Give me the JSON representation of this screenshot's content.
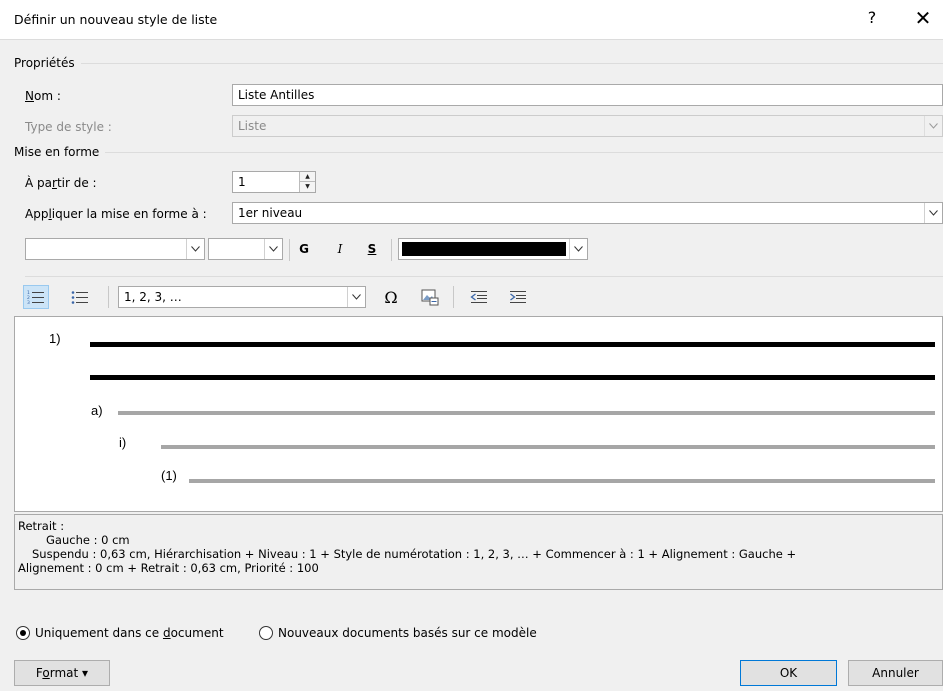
{
  "window": {
    "title": "Définir un nouveau style de liste",
    "help_label": "?",
    "close_label": "✕"
  },
  "properties": {
    "section_label": "Propriétés",
    "name_label_u": "N",
    "name_label_rest": "om :",
    "name_value": "Liste Antilles",
    "style_type_label": "Type de style :",
    "style_type_value": "Liste"
  },
  "formatting": {
    "section_label": "Mise en forme",
    "start_at_label_a": "À pa",
    "start_at_label_u": "r",
    "start_at_label_b": "tir de :",
    "start_at_value": "1",
    "apply_label_a": "App",
    "apply_label_u": "l",
    "apply_label_b": "iquer la mise en forme à :",
    "apply_value": "1er niveau",
    "font_value": "",
    "size_value": "",
    "bold_label": "G",
    "italic_label": "I",
    "underline_label": "S",
    "font_color": "#000000",
    "numbering_value": "1, 2, 3, …",
    "symbol_label": "Ω"
  },
  "preview": {
    "levels": [
      {
        "label": "1)"
      },
      {
        "label": "a)"
      },
      {
        "label": "i)"
      },
      {
        "label": "(1)"
      }
    ]
  },
  "description": {
    "line1": "Retrait :",
    "line2": "Gauche :  0 cm",
    "line3": "Suspendu : 0,63 cm, Hiérarchisation + Niveau : 1 + Style de numérotation : 1, 2, 3, … + Commencer à : 1 + Alignement : Gauche +",
    "line4": "Alignement :  0 cm + Retrait :  0,63 cm, Priorité : 100"
  },
  "scope": {
    "option1_a": "Uniquement dans ce ",
    "option1_u": "d",
    "option1_b": "ocument",
    "option1_selected": true,
    "option2": "Nouveaux documents basés sur ce modèle"
  },
  "footer": {
    "format_a": "F",
    "format_u": "o",
    "format_b": "rmat ▾",
    "ok_label": "OK",
    "cancel_label": "Annuler"
  }
}
